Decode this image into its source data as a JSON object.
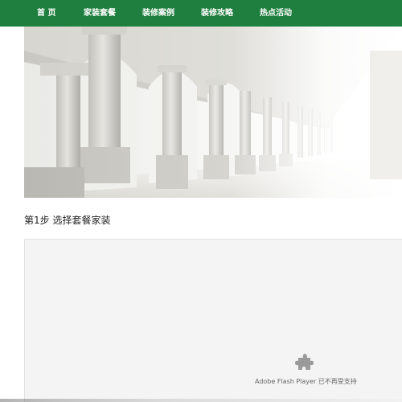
{
  "nav": {
    "items": [
      {
        "label": "首 页"
      },
      {
        "label": "家装套餐"
      },
      {
        "label": "装修案例"
      },
      {
        "label": "装修攻略"
      },
      {
        "label": "热点活动"
      }
    ],
    "background_color": "#1f7f3f"
  },
  "hero": {
    "image_subject": "white classical colonnade with arches"
  },
  "step": {
    "title": "第1步 选择套餐家装"
  },
  "flash": {
    "icon": "puzzle-plugin-icon",
    "message": "Adobe Flash Player 已不再受支持"
  }
}
